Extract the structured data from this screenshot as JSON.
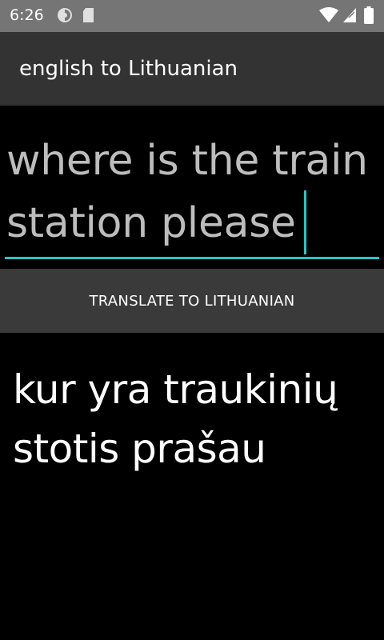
{
  "status_bar": {
    "time": "6:26",
    "icons_left": [
      "sync-icon",
      "sim-card-icon"
    ],
    "icons_right": [
      "wifi-icon",
      "cell-signal-icon",
      "battery-icon"
    ]
  },
  "app_bar": {
    "title": "english to Lithuanian"
  },
  "input": {
    "value": "where is the train station please"
  },
  "translate_button": {
    "label": "TRANSLATE TO LITHUANIAN"
  },
  "output": {
    "text": "kur yra traukinių stotis prašau"
  },
  "colors": {
    "status_bar": "#757575",
    "app_bar": "#333333",
    "accent": "#26c6c6",
    "button": "#3a3a3a",
    "background": "#000000"
  }
}
